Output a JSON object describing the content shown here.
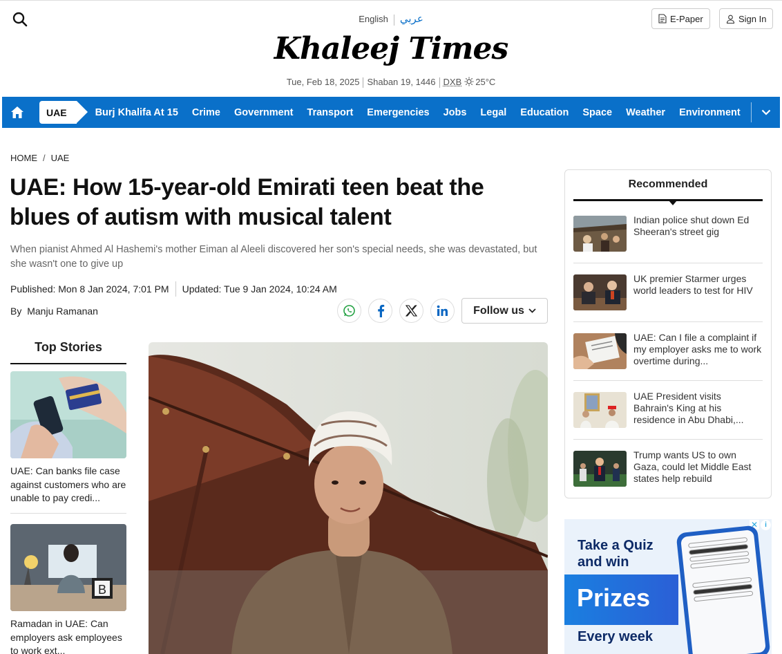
{
  "header": {
    "lang_en": "English",
    "lang_ar": "عربي",
    "logo": "Khaleej Times",
    "date": "Tue, Feb 18, 2025",
    "hijri": "Shaban 19, 1446",
    "city": "DXB",
    "temp": "25°C",
    "epaper_label": "E-Paper",
    "signin_label": "Sign In"
  },
  "nav": {
    "section": "UAE",
    "items": [
      "Burj Khalifa At 15",
      "Crime",
      "Government",
      "Transport",
      "Emergencies",
      "Jobs",
      "Legal",
      "Education",
      "Space",
      "Weather",
      "Environment"
    ]
  },
  "breadcrumb": {
    "home": "HOME",
    "sep": "/",
    "current": "UAE"
  },
  "article": {
    "headline": "UAE: How 15-year-old Emirati teen beat the blues of autism with musical talent",
    "summary": "When pianist Ahmed Al Hashemi's mother Eiman al Aleeli discovered her son's special needs, she was devastated, but she wasn't one to give up",
    "published": "Published: Mon 8 Jan 2024, 7:01 PM",
    "updated": "Updated: Tue 9 Jan 2024, 10:24 AM",
    "by": "By",
    "author": "Manju Ramanan",
    "follow_label": "Follow us"
  },
  "top_stories": {
    "title": "Top Stories",
    "items": [
      {
        "text": "UAE: Can banks file case against customers who are unable to pay credi..."
      },
      {
        "text": "Ramadan in UAE: Can employers ask employees to work ext..."
      }
    ]
  },
  "recommended": {
    "title": "Recommended",
    "items": [
      {
        "text": "Indian police shut down Ed Sheeran's street gig"
      },
      {
        "text": "UK premier Starmer urges world leaders to test for HIV"
      },
      {
        "text": "UAE: Can I file a complaint if my employer asks me to work overtime during..."
      },
      {
        "text": "UAE President visits Bahrain's King at his residence in Abu Dhabi,..."
      },
      {
        "text": "Trump wants US to own Gaza, could let Middle East states help rebuild"
      }
    ]
  },
  "ad": {
    "line1": "Take a Quiz",
    "line2": "and win",
    "prizes": "Prizes",
    "week": "Every week"
  },
  "colors": {
    "brand_blue": "#0a70c9",
    "ad_navy": "#0d2a66"
  }
}
